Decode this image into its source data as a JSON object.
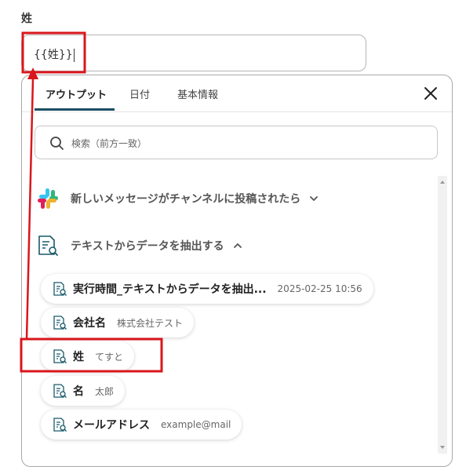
{
  "field": {
    "label": "姓",
    "value": "{{姓}}"
  },
  "tabs": [
    {
      "label": "アウトプット",
      "active": true
    },
    {
      "label": "日付",
      "active": false
    },
    {
      "label": "基本情報",
      "active": false
    }
  ],
  "search": {
    "placeholder": "検索（前方一致）"
  },
  "sections": [
    {
      "title": "新しいメッセージがチャンネルに投稿されたら",
      "expanded": false,
      "icon": "slack-icon"
    },
    {
      "title": "テキストからデータを抽出する",
      "expanded": true,
      "icon": "document-search-icon"
    }
  ],
  "outputs": [
    {
      "name": "実行時間_テキストからデータを抽出...",
      "value": "2025-02-25 10:56"
    },
    {
      "name": "会社名",
      "value": "株式会社テスト"
    },
    {
      "name": "姓",
      "value": "てすと"
    },
    {
      "name": "名",
      "value": "太郎"
    },
    {
      "name": "メールアドレス",
      "value": "example@mail"
    }
  ],
  "colors": {
    "highlight": "#d9161c",
    "tab_underline": "#1a4f63"
  }
}
